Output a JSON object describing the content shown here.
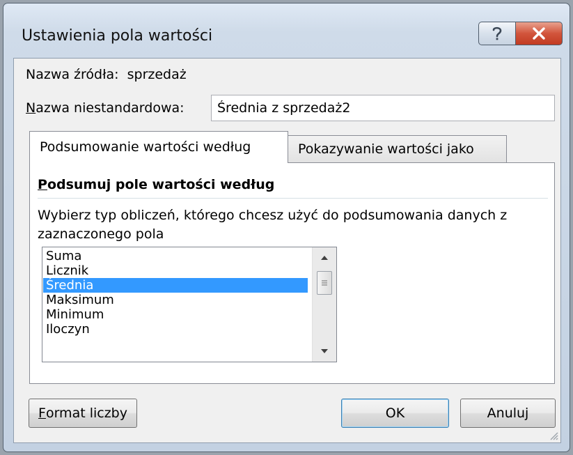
{
  "window": {
    "title": "Ustawienia pola wartości"
  },
  "source": {
    "label": "Nazwa źródła:",
    "value": "sprzedaż"
  },
  "custom_name": {
    "label_first": "N",
    "label_rest": "azwa niestandardowa:",
    "value": "Średnia z sprzedaż2"
  },
  "tabs": [
    {
      "label": "Podsumowanie wartości według",
      "active": true
    },
    {
      "label": "Pokazywanie wartości jako",
      "active": false
    }
  ],
  "summary": {
    "title_first": "P",
    "title_rest": "odsumuj pole wartości według",
    "description": "Wybierz typ obliczeń, którego chcesz użyć do podsumowania danych z zaznaczonego pola",
    "items": [
      "Suma",
      "Licznik",
      "Średnia",
      "Maksimum",
      "Minimum",
      "Iloczyn"
    ],
    "selected": "Średnia"
  },
  "buttons": {
    "format_first": "F",
    "format_rest": "ormat liczby",
    "ok": "OK",
    "cancel": "Anuluj"
  },
  "icons": {
    "help": "question-mark-icon",
    "close": "close-x-icon",
    "scroll_up": "arrow-up-icon",
    "scroll_down": "arrow-down-icon",
    "thumb": "grip-lines-icon",
    "resize": "resize-grip-icon"
  },
  "colors": {
    "selection": "#3399ff",
    "close_button": "#c94a31",
    "window_frame": "#c3d1e2"
  }
}
